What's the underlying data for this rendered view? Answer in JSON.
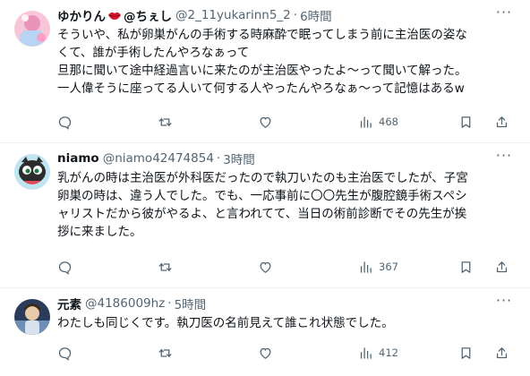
{
  "tweets": [
    {
      "name_prefix": "ゆかりん",
      "name_suffix": "@ちぇし",
      "handle": "@2_11yukarinn5_2",
      "dot": "·",
      "time": "6時間",
      "lines": [
        "そういや、私が卵巣がんの手術する時麻酔で眠ってしまう前に主治医の姿な",
        "くて、誰が手術したんやろなぁって",
        "旦那に聞いて途中経過言いに来たのが主治医やったよ～って聞いて解った。",
        "一人偉そうに座ってる人いて何する人やったんやろなぁ～って記憶はあるw"
      ],
      "views": "468"
    },
    {
      "name": "niamo",
      "handle": "@niamo42474854",
      "dot": "·",
      "time": "3時間",
      "lines": [
        "乳がんの時は主治医が外科医だったので執刀いたのも主治医でしたが、子宮",
        "卵巣の時は、違う人でした。でも、一応事前に〇〇先生が腹腔鏡手術スペシ",
        "ャリストだから彼がやるよ、と言われてて、当日の術前診断でその先生が挨",
        "拶に来ました。"
      ],
      "views": "367"
    },
    {
      "name": "元素",
      "handle": "@4186009hz",
      "dot": "·",
      "time": "5時間",
      "lines": [
        "わたしも同じくです。執刀医の名前見えて誰これ状態でした。"
      ],
      "views": "412"
    }
  ],
  "more_label": "···"
}
